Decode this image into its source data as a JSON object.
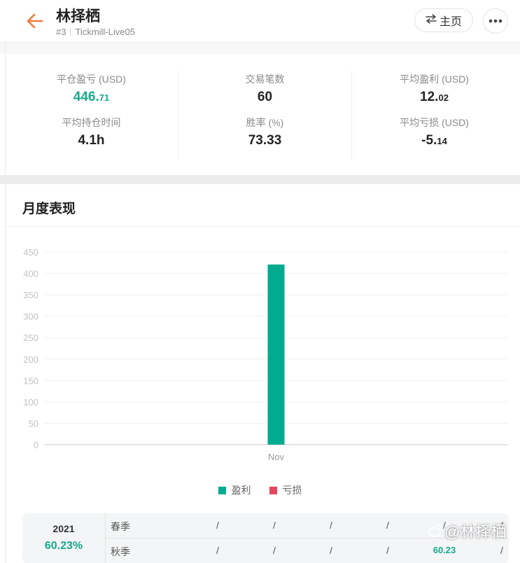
{
  "header": {
    "title": "林择栖",
    "rank": "#3",
    "account": "Tickmill-Live05",
    "home_label": "主页"
  },
  "stats": [
    [
      {
        "label": "平仓盈亏 (USD)",
        "int": "446.",
        "dec": "71",
        "color": "green"
      },
      {
        "label": "平均持仓时间",
        "int": "4.1h",
        "dec": "",
        "color": "dark"
      }
    ],
    [
      {
        "label": "交易笔数",
        "int": "60",
        "dec": "",
        "color": "dark"
      },
      {
        "label": "胜率 (%)",
        "int": "73.33",
        "dec": "",
        "color": "dark"
      }
    ],
    [
      {
        "label": "平均盈利 (USD)",
        "int": "12.",
        "dec": "02",
        "color": "dark"
      },
      {
        "label": "平均亏损 (USD)",
        "int": "-5.",
        "dec": "14",
        "color": "dark"
      }
    ]
  ],
  "section": {
    "title": "月度表现"
  },
  "chart_data": {
    "type": "bar",
    "categories": [
      "Nov"
    ],
    "series": [
      {
        "name": "盈利",
        "values": [
          421
        ],
        "color": "#00ab8e"
      },
      {
        "name": "亏损",
        "values": [
          0
        ],
        "color": "#e5465e"
      }
    ],
    "yticks": [
      0,
      50,
      100,
      150,
      200,
      250,
      300,
      350,
      400,
      450
    ],
    "ylim": [
      0,
      450
    ],
    "grid": true,
    "legend_position": "bottom"
  },
  "season": {
    "year": "2021",
    "percent": "60.23%",
    "rows": [
      {
        "label": "春季",
        "cells": [
          "/",
          "/",
          "/",
          "/",
          "/",
          "/"
        ]
      },
      {
        "label": "秋季",
        "cells": [
          "/",
          "/",
          "/",
          "/",
          "60.23",
          "/"
        ]
      }
    ]
  },
  "watermark": {
    "text": "@林择栖"
  }
}
